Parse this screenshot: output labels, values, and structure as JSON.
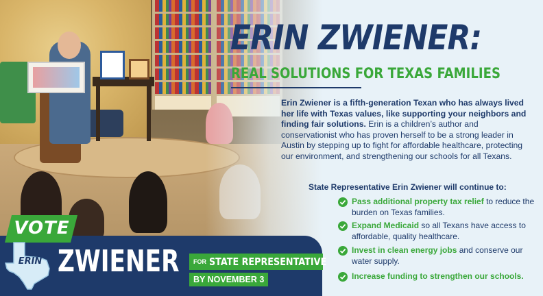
{
  "headline": "ERIN ZWIENER:",
  "subhead": "REAL SOLUTIONS FOR TEXAS FAMILIES",
  "bio": {
    "lead": "Erin Zwiener is a fifth-generation Texan who has always lived her life with Texas values, like supporting your neighbors and finding fair solutions.",
    "rest": " Erin is a children’s author and conservationist who has proven herself to be a strong leader in Austin by stepping up to fight for affordable healthcare, protecting our environment, and strengthening our schools for all Texans."
  },
  "list_title": "State Representative Erin Zwiener will continue to:",
  "items": [
    {
      "highlight": "Pass additional property tax relief",
      "rest": " to reduce the burden on Texas families."
    },
    {
      "highlight": "Expand Medicaid",
      "rest": " so all Texans have access to affordable, quality healthcare."
    },
    {
      "highlight": "Invest in clean energy jobs",
      "rest": " and conserve our water supply."
    },
    {
      "highlight": "Increase funding to strengthen our schools.",
      "rest": ""
    }
  ],
  "banner": {
    "vote": "VOTE",
    "texas_label": "ERIN",
    "name": "ZWIENER",
    "office_prefix": "FOR",
    "office": "STATE REPRESENTATIVE",
    "deadline": "BY NOVEMBER 3"
  },
  "colors": {
    "navy": "#1e3a6a",
    "green": "#3aa83a",
    "background": "#e8f2f8"
  },
  "icons": [
    "check-circle-icon",
    "texas-map-icon"
  ]
}
